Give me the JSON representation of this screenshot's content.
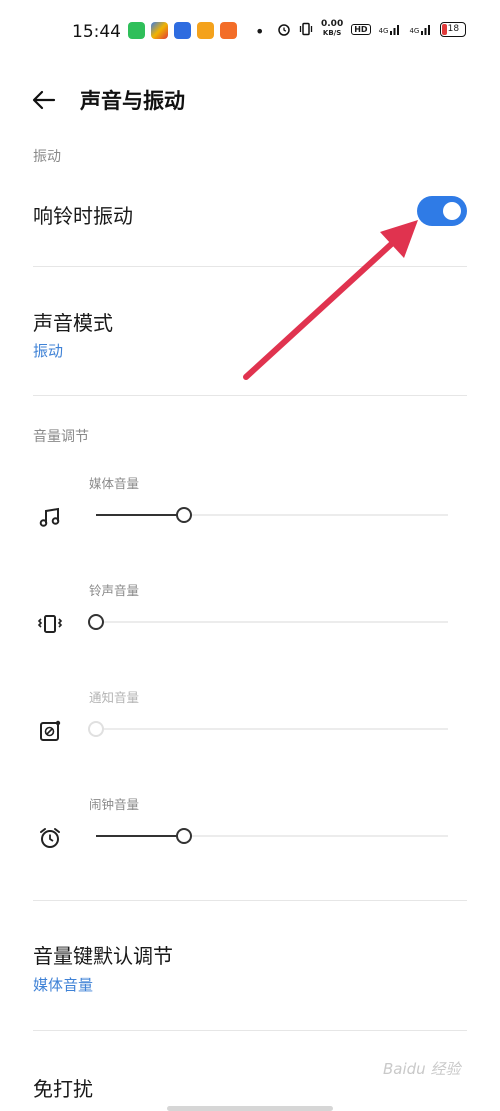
{
  "status_bar": {
    "time": "15:44",
    "speed_value": "0.00",
    "speed_unit": "KB/S",
    "hd": "HD",
    "net1": "4G",
    "net2": "4G",
    "battery": "18",
    "dot": "•"
  },
  "header": {
    "title": "声音与振动"
  },
  "vibration": {
    "section_label": "振动",
    "ring_vibrate_label": "响铃时振动",
    "ring_vibrate_on": true
  },
  "sound_mode": {
    "title": "声音模式",
    "value": "振动"
  },
  "volume": {
    "section_label": "音量调节",
    "sliders": [
      {
        "label": "媒体音量",
        "icon": "music-note-icon",
        "level": 0.25,
        "enabled": true
      },
      {
        "label": "铃声音量",
        "icon": "vibrate-icon",
        "level": 0.0,
        "enabled": true
      },
      {
        "label": "通知音量",
        "icon": "notification-icon",
        "level": 0.0,
        "enabled": false
      },
      {
        "label": "闹钟音量",
        "icon": "alarm-clock-icon",
        "level": 0.25,
        "enabled": true
      }
    ]
  },
  "volume_key": {
    "title": "音量键默认调节",
    "value": "媒体音量"
  },
  "dnd": {
    "title": "免打扰"
  },
  "watermark": "Baidu 经验",
  "colors": {
    "accent": "#2f7be6",
    "link": "#3f82d6",
    "arrow": "#e0334f"
  }
}
